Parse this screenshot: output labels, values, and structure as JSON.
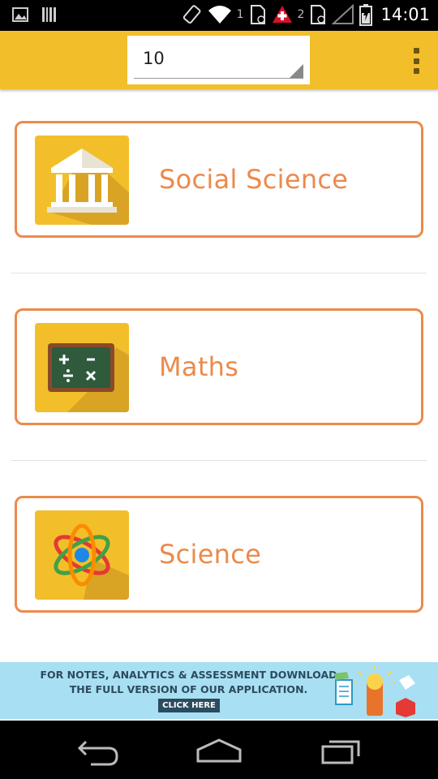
{
  "status_bar": {
    "time": "14:01",
    "sim1": "1",
    "sim2": "2",
    "icons": [
      "image-icon",
      "barcode-icon",
      "rotate-icon",
      "wifi-icon",
      "sim-icon",
      "alert-icon",
      "sim-icon",
      "signal-icon",
      "battery-icon"
    ]
  },
  "toolbar": {
    "class_select_value": "10",
    "background": "#f2bf2b"
  },
  "subjects": [
    {
      "label": "Social Science",
      "icon": "bank-building-icon"
    },
    {
      "label": "Maths",
      "icon": "chalkboard-math-icon"
    },
    {
      "label": "Science",
      "icon": "atom-icon"
    }
  ],
  "ad": {
    "line1": "FOR NOTES, ANALYTICS & ASSESSMENT DOWNLOAD",
    "line2": "THE FULL VERSION OF OUR APPLICATION.",
    "cta": "CLICK HERE"
  },
  "colors": {
    "accent": "#ec8a4b",
    "toolbar": "#f2bf2b",
    "ad_bg": "#a9dff2"
  }
}
